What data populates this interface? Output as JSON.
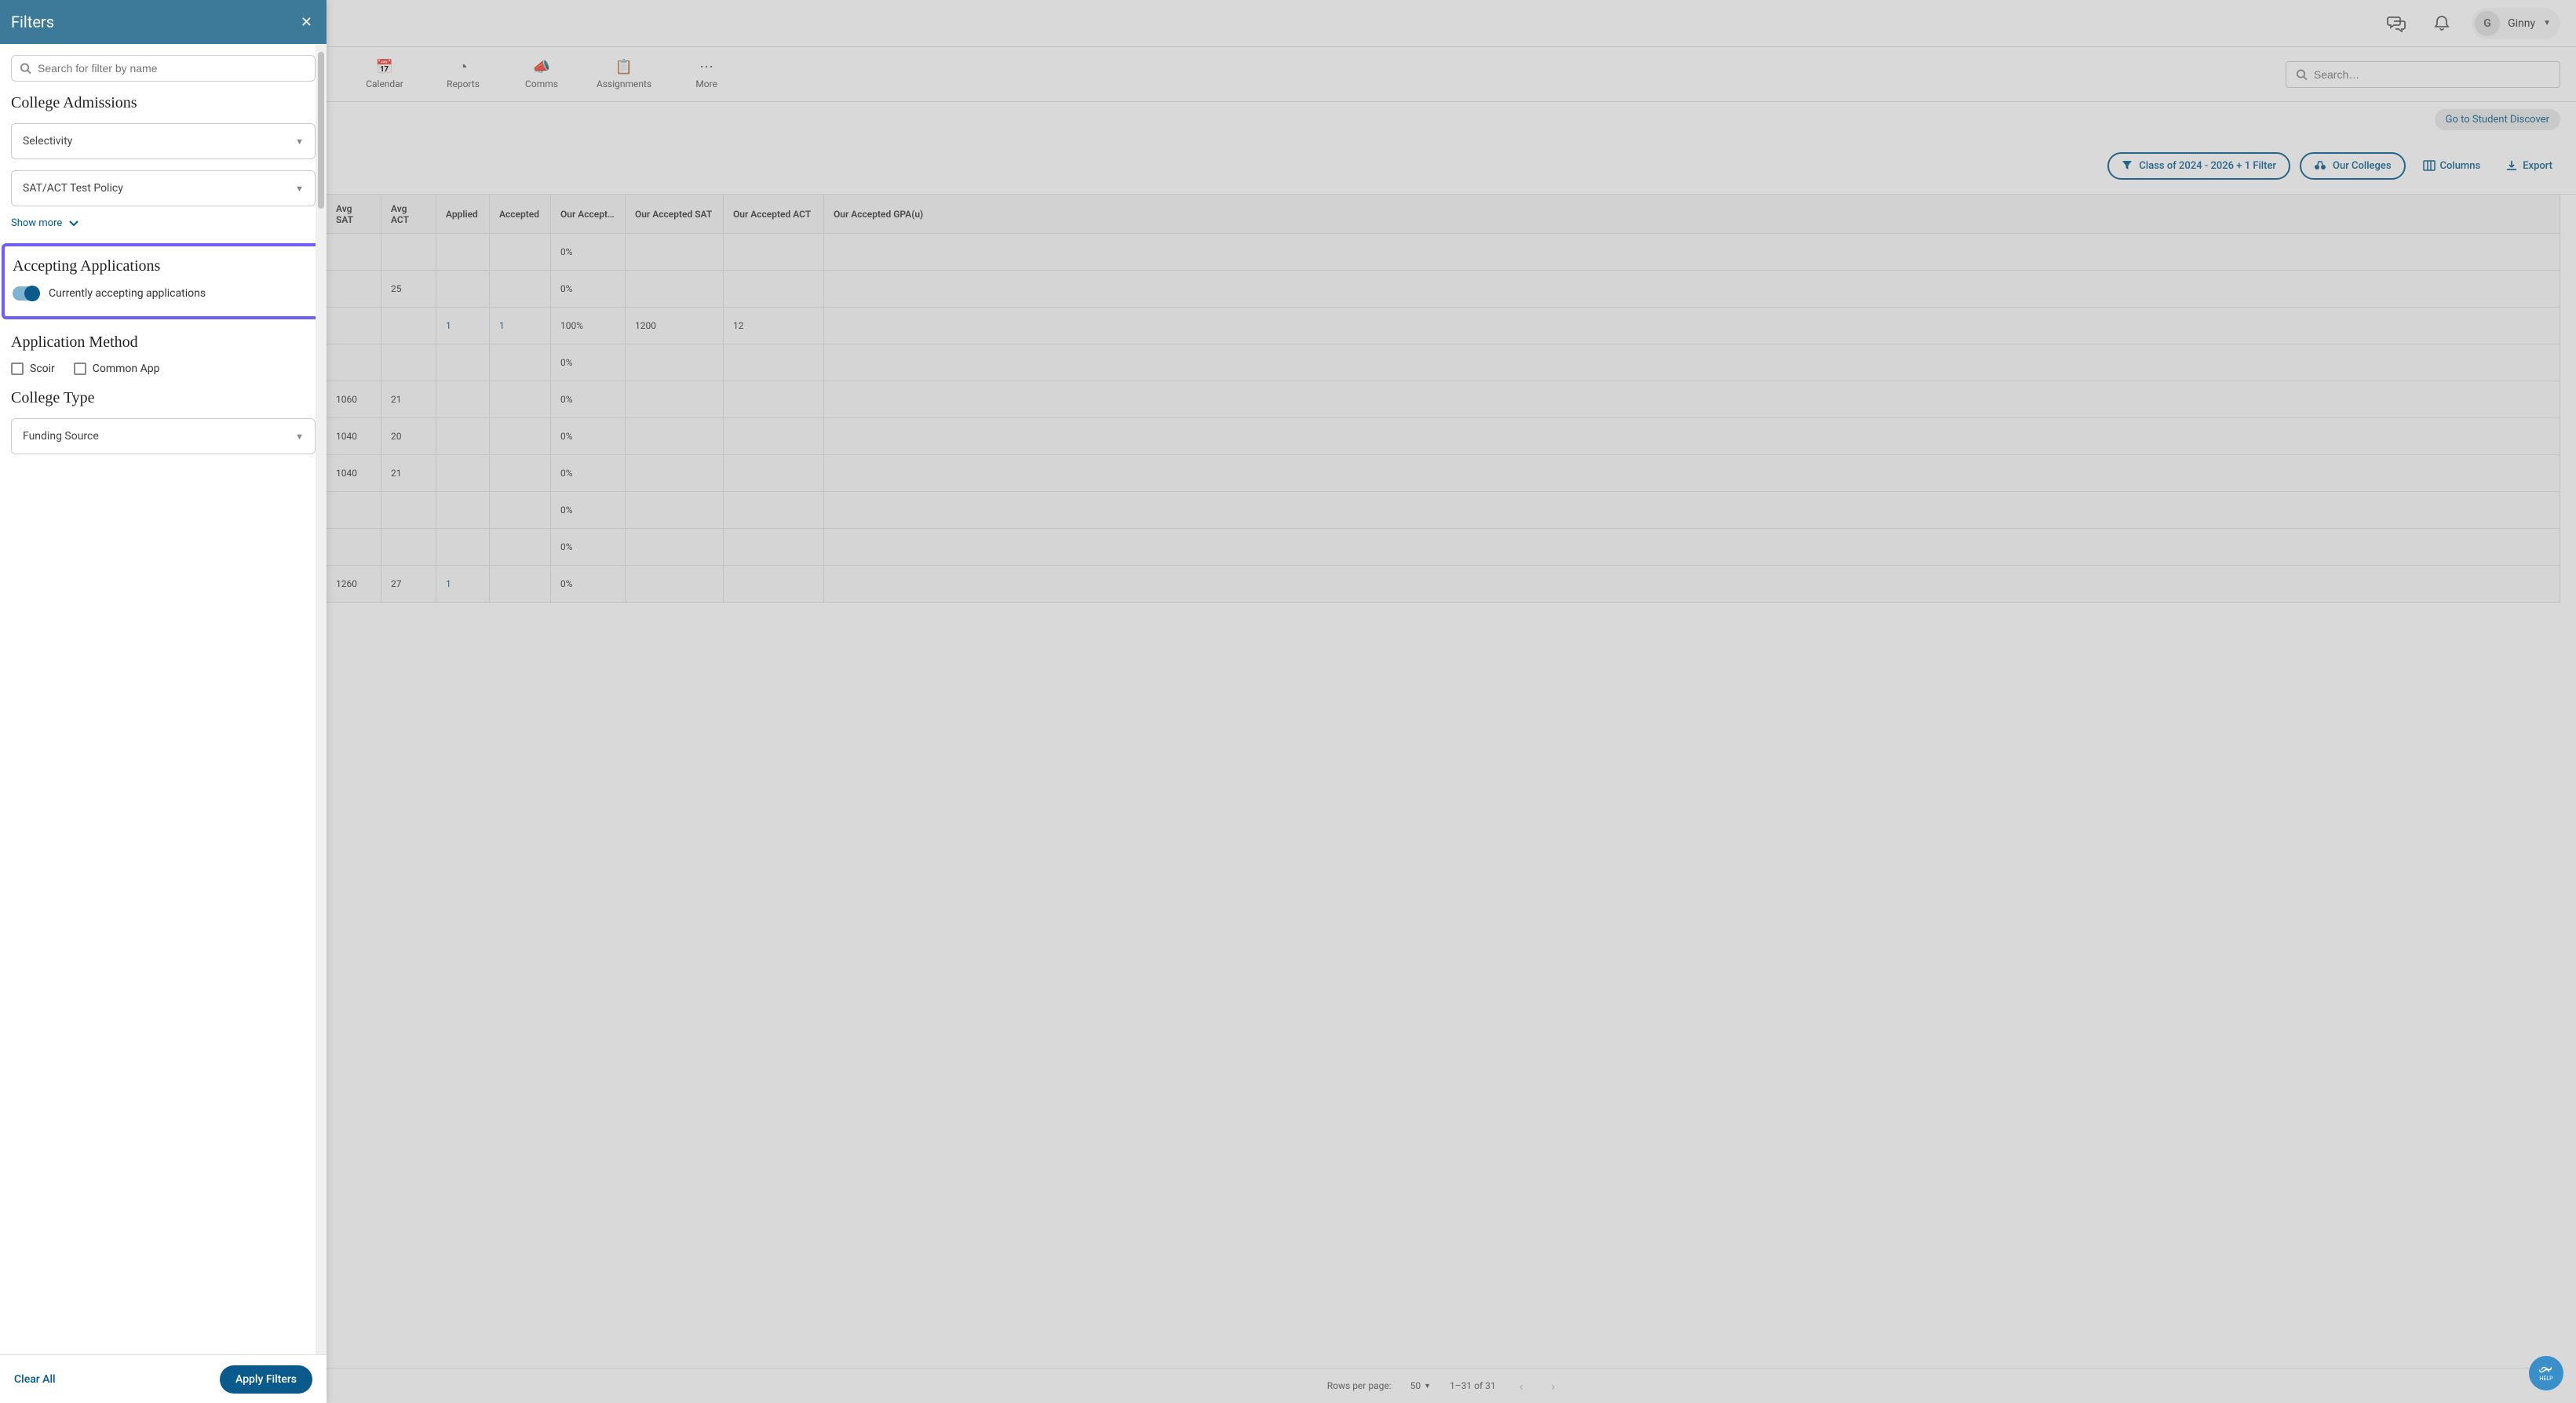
{
  "filters_panel": {
    "title": "Filters",
    "search_placeholder": "Search for filter by name",
    "section_college_admissions": "College Admissions",
    "dropdown_selectivity": "Selectivity",
    "dropdown_test_policy": "SAT/ACT Test Policy",
    "show_more": "Show more",
    "section_accepting": "Accepting Applications",
    "toggle_accepting_label": "Currently accepting applications",
    "section_method": "Application Method",
    "checkbox_scoir": "Scoir",
    "checkbox_common": "Common App",
    "section_college_type": "College Type",
    "dropdown_funding": "Funding Source",
    "clear_all": "Clear All",
    "apply": "Apply Filters"
  },
  "topbar": {
    "avatar_letter": "G",
    "username": "Ginny"
  },
  "nav": {
    "calendar": "Calendar",
    "reports": "Reports",
    "comms": "Comms",
    "assignments": "Assignments",
    "more": "More",
    "search_placeholder": "Search…"
  },
  "subheader": {
    "discover_link": "Go to Student Discover"
  },
  "toolbar": {
    "filter_pill": "Class of 2024 - 2026 + 1 Filter",
    "our_colleges": "Our Colleges",
    "columns": "Columns",
    "export": "Export"
  },
  "table": {
    "headers": {
      "avg_sat": "Avg SAT",
      "avg_act": "Avg ACT",
      "applied": "Applied",
      "accepted": "Accepted",
      "our_accept": "Our Accept…",
      "our_sat": "Our Accepted SAT",
      "our_act": "Our Accepted ACT",
      "our_gpa": "Our Accepted GPA(u)"
    },
    "rows": [
      {
        "avg_sat": "",
        "avg_act": "",
        "applied": "",
        "accepted": "",
        "our_accept": "0%",
        "our_sat": "",
        "our_act": "",
        "our_gpa": ""
      },
      {
        "avg_sat": "",
        "avg_act": "25",
        "applied": "",
        "accepted": "",
        "our_accept": "0%",
        "our_sat": "",
        "our_act": "",
        "our_gpa": ""
      },
      {
        "avg_sat": "",
        "avg_act": "",
        "applied": "1",
        "accepted": "1",
        "our_accept": "100%",
        "our_sat": "1200",
        "our_act": "12",
        "our_gpa": "",
        "applied_link": true,
        "accepted_link": true
      },
      {
        "avg_sat": "",
        "avg_act": "",
        "applied": "",
        "accepted": "",
        "our_accept": "0%",
        "our_sat": "",
        "our_act": "",
        "our_gpa": ""
      },
      {
        "avg_sat": "1060",
        "avg_act": "21",
        "applied": "",
        "accepted": "",
        "our_accept": "0%",
        "our_sat": "",
        "our_act": "",
        "our_gpa": ""
      },
      {
        "avg_sat": "1040",
        "avg_act": "20",
        "applied": "",
        "accepted": "",
        "our_accept": "0%",
        "our_sat": "",
        "our_act": "",
        "our_gpa": ""
      },
      {
        "avg_sat": "1040",
        "avg_act": "21",
        "applied": "",
        "accepted": "",
        "our_accept": "0%",
        "our_sat": "",
        "our_act": "",
        "our_gpa": ""
      },
      {
        "avg_sat": "",
        "avg_act": "",
        "applied": "",
        "accepted": "",
        "our_accept": "0%",
        "our_sat": "",
        "our_act": "",
        "our_gpa": ""
      },
      {
        "avg_sat": "",
        "avg_act": "",
        "applied": "",
        "accepted": "",
        "our_accept": "0%",
        "our_sat": "",
        "our_act": "",
        "our_gpa": ""
      },
      {
        "avg_sat": "1260",
        "avg_act": "27",
        "applied": "1",
        "accepted": "",
        "our_accept": "0%",
        "our_sat": "",
        "our_act": "",
        "our_gpa": "",
        "applied_link": true
      }
    ]
  },
  "footer": {
    "rows_per_page_label": "Rows per page:",
    "rows_per_page_value": "50",
    "range": "1–31 of 31"
  },
  "help": {
    "label": "HELP"
  }
}
